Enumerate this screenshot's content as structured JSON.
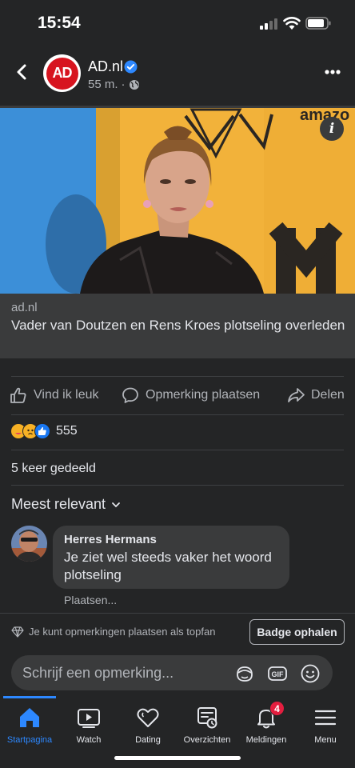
{
  "status_bar": {
    "time": "15:54"
  },
  "post": {
    "page_name": "AD.nl",
    "avatar_text": "AD",
    "time_ago": "55 m.",
    "separator": "·",
    "link_domain": "ad.nl",
    "link_title": "Vader van Doutzen en Rens Kroes plotseling overleden",
    "info_glyph": "i"
  },
  "actions": {
    "like": "Vind ik leuk",
    "comment": "Opmerking plaatsen",
    "share": "Delen"
  },
  "reactions": {
    "count": "555",
    "types": [
      "care-icon",
      "sad-icon",
      "like-icon"
    ]
  },
  "shares": "5 keer gedeeld",
  "comments_sort": "Meest relevant",
  "comment": {
    "author": "Herres Hermans",
    "text": "Je ziet wel steeds vaker het woord plotseling",
    "reply_label": "Plaatsen..."
  },
  "topfan": {
    "text": "Je kunt opmerkingen plaatsen als topfan",
    "button": "Badge ophalen"
  },
  "composer": {
    "placeholder": "Schrijf een opmerking...",
    "gif_label": "GIF"
  },
  "tabs": [
    {
      "label": "Startpagina",
      "icon": "home-icon",
      "active": true
    },
    {
      "label": "Watch",
      "icon": "watch-icon"
    },
    {
      "label": "Dating",
      "icon": "dating-icon"
    },
    {
      "label": "Overzichten",
      "icon": "memories-icon"
    },
    {
      "label": "Meldingen",
      "icon": "bell-icon",
      "badge": "4"
    },
    {
      "label": "Menu",
      "icon": "menu-icon"
    }
  ],
  "colors": {
    "accent": "#2d88ff",
    "background": "#242526",
    "surface": "#3a3b3c",
    "brand_red": "#d7141f",
    "badge_red": "#e41e3f"
  }
}
